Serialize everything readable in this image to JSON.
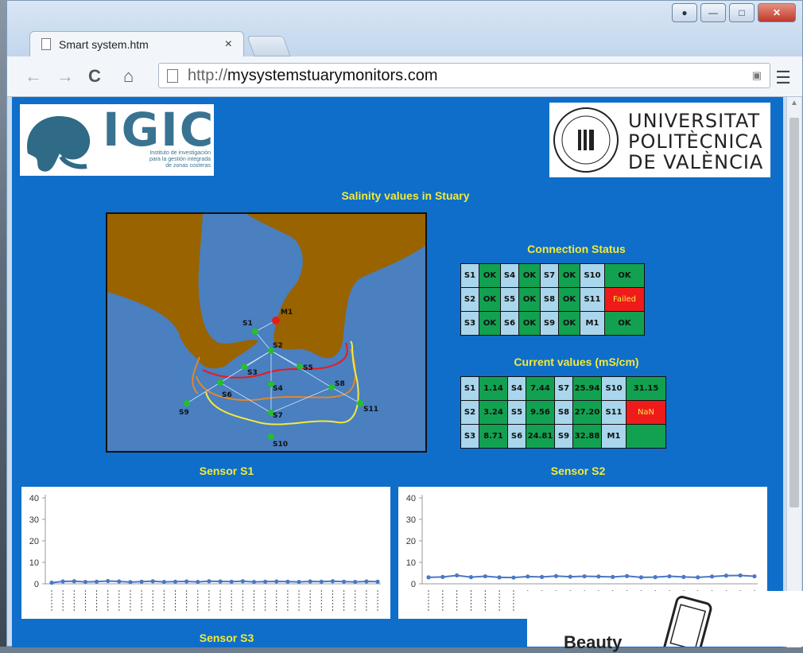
{
  "browser": {
    "tab_title": "Smart system.htm",
    "tab_close": "×",
    "url_prefix": "http://",
    "url_domain": "mysystemstuarymonitors.com"
  },
  "page": {
    "igic_logo_text": "IGIC",
    "igic_logo_subtext": [
      "Instituto de investigación",
      "para la gestión integrada",
      "de zonas costeras"
    ],
    "upv_logo_lines": [
      "UNIVERSITAT",
      "POLITÈCNICA",
      "DE VALÈNCIA"
    ],
    "main_heading": "Salinity values in Stuary",
    "connection_heading": "Connection Status",
    "current_heading": "Current values (mS/cm)",
    "sensor1_heading": "Sensor S1",
    "sensor2_heading": "Sensor S2",
    "sensor3_heading": "Sensor S3"
  },
  "map_labels": [
    "M1",
    "S1",
    "S2",
    "S3",
    "S4",
    "S5",
    "S6",
    "S7",
    "S8",
    "S9",
    "S10",
    "S11"
  ],
  "connection_status": [
    [
      {
        "l": "S1",
        "v": "OK"
      },
      {
        "l": "S4",
        "v": "OK"
      },
      {
        "l": "S7",
        "v": "OK"
      },
      {
        "l": "S10",
        "v": "OK"
      }
    ],
    [
      {
        "l": "S2",
        "v": "OK"
      },
      {
        "l": "S5",
        "v": "OK"
      },
      {
        "l": "S8",
        "v": "OK"
      },
      {
        "l": "S11",
        "v": "Failed"
      }
    ],
    [
      {
        "l": "S3",
        "v": "OK"
      },
      {
        "l": "S6",
        "v": "OK"
      },
      {
        "l": "S9",
        "v": "OK"
      },
      {
        "l": "M1",
        "v": "OK"
      }
    ]
  ],
  "current_values": [
    [
      {
        "l": "S1",
        "v": "1.14"
      },
      {
        "l": "S4",
        "v": "7.44"
      },
      {
        "l": "S7",
        "v": "25.94"
      },
      {
        "l": "S10",
        "v": "31.15"
      }
    ],
    [
      {
        "l": "S2",
        "v": "3.24"
      },
      {
        "l": "S5",
        "v": "9.56"
      },
      {
        "l": "S8",
        "v": "27.20"
      },
      {
        "l": "S11",
        "v": "NaN"
      }
    ],
    [
      {
        "l": "S3",
        "v": "8.71"
      },
      {
        "l": "S6",
        "v": "24.81"
      },
      {
        "l": "S9",
        "v": "32.88"
      },
      {
        "l": "M1",
        "v": ""
      }
    ]
  ],
  "colors": {
    "page_bg": "#0f6ec9",
    "heading": "#f2ea3a",
    "ok": "#12a150",
    "failed": "#ef1a1a",
    "label": "#a9d6ec",
    "land": "#996300",
    "water": "#4a7fc0"
  },
  "chart_data": [
    {
      "type": "line",
      "ylim": [
        0,
        40
      ],
      "yticks": [
        "0",
        "10",
        "20",
        "30",
        "40"
      ],
      "series": [
        {
          "values": [
            0.5,
            1.1,
            1.2,
            0.9,
            1.0,
            1.3,
            1.1,
            0.8,
            1.0,
            1.2,
            0.9,
            1.0,
            1.1,
            0.9,
            1.2,
            1.1,
            1.0,
            1.2,
            0.9,
            1.0,
            1.1,
            1.0,
            0.9,
            1.1,
            1.0,
            1.2,
            1.0,
            0.9,
            1.1,
            1.0
          ]
        }
      ]
    },
    {
      "type": "line",
      "ylim": [
        0,
        40
      ],
      "yticks": [
        "0",
        "10",
        "20",
        "30",
        "40"
      ],
      "series": [
        {
          "values": [
            3.0,
            3.2,
            3.9,
            3.1,
            3.5,
            3.0,
            2.9,
            3.4,
            3.2,
            3.6,
            3.3,
            3.5,
            3.4,
            3.2,
            3.6,
            3.0,
            3.1,
            3.5,
            3.2,
            3.0,
            3.4,
            3.8,
            3.9,
            3.5
          ]
        }
      ]
    }
  ],
  "overlay": {
    "phone_text": "Beauty"
  }
}
